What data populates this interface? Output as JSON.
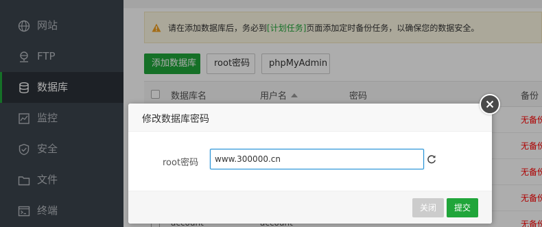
{
  "sidebar": {
    "items": [
      {
        "label": "网站",
        "icon": "globe-icon",
        "active": false
      },
      {
        "label": "FTP",
        "icon": "ftp-icon",
        "active": false
      },
      {
        "label": "数据库",
        "icon": "database-icon",
        "active": true
      },
      {
        "label": "监控",
        "icon": "monitor-icon",
        "active": false
      },
      {
        "label": "安全",
        "icon": "shield-icon",
        "active": false
      },
      {
        "label": "文件",
        "icon": "folder-icon",
        "active": false
      },
      {
        "label": "终端",
        "icon": "terminal-icon",
        "active": false
      }
    ]
  },
  "notice": {
    "icon": "warning-icon",
    "text_before": "请在添加数据库后，务必到",
    "link": "[计划任务]",
    "text_after": "页面添加定时备份任务，以确保您的数据安全。"
  },
  "toolbar": {
    "add_db": "添加数据库",
    "root_pwd": "root密码",
    "phpmyadmin": "phpMyAdmin"
  },
  "table": {
    "columns": [
      "数据库名",
      "用户名",
      "密码",
      "备份"
    ],
    "rows": [
      {
        "db": "",
        "user": "",
        "backup": "无备份"
      },
      {
        "db": "",
        "user": "",
        "backup": "无备份"
      },
      {
        "db": "",
        "user": "",
        "backup": "无备份"
      },
      {
        "db": "",
        "user": "",
        "backup": "无备份"
      },
      {
        "db": "account",
        "user": "account",
        "backup": "无备份"
      }
    ]
  },
  "modal": {
    "title": "修改数据库密码",
    "field_label": "root密码",
    "field_value": "www.300000.cn",
    "close_label": "关闭",
    "submit_label": "提交"
  },
  "colors": {
    "brand_green": "#20a53a",
    "sidebar_bg": "#3c444d",
    "danger_red": "#ff0000",
    "input_focus": "#1f8fd5"
  }
}
